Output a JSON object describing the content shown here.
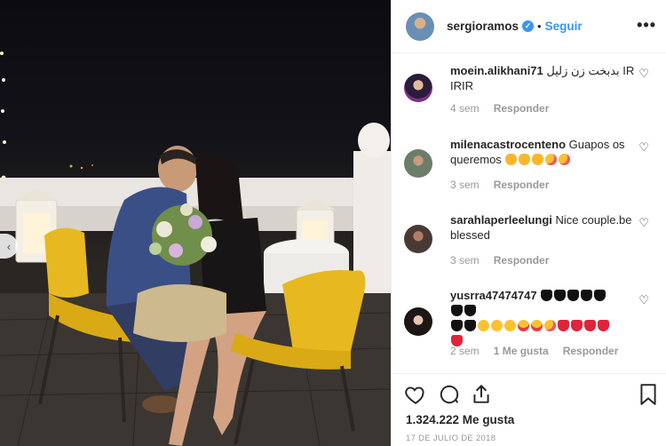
{
  "photo": {
    "alt": ""
  },
  "post": {
    "username": "sergioramos",
    "separator": "•",
    "follow_label": "Seguir",
    "more_label": "•••",
    "likes": "1.324.222 Me gusta",
    "date": "17 DE JULIO DE 2018"
  },
  "comments": [
    {
      "username": "moein.alikhani71",
      "text": "بدبخت زن زلیل IR IRIR",
      "age": "4 sem",
      "reply": "Responder",
      "likes_label": ""
    },
    {
      "username": "milenacastrocenteno",
      "text": "Guapos os queremos",
      "age": "3 sem",
      "reply": "Responder",
      "likes_label": ""
    },
    {
      "username": "sarahlaperleelungi",
      "text": "Nice couple.be blessed",
      "age": "3 sem",
      "reply": "Responder",
      "likes_label": ""
    },
    {
      "username": "yusrra47474747",
      "text": "",
      "age": "2 sem",
      "reply": "Responder",
      "likes_label": "1 Me gusta"
    }
  ],
  "colors": {
    "accent": "#3897f0",
    "chair": "#e7b820",
    "text": "#262626",
    "muted": "#999999"
  },
  "icons": [
    "heart-icon",
    "comment-icon",
    "share-icon",
    "bookmark-icon",
    "verified-badge-icon",
    "more-options-icon",
    "chevron-left-icon"
  ]
}
